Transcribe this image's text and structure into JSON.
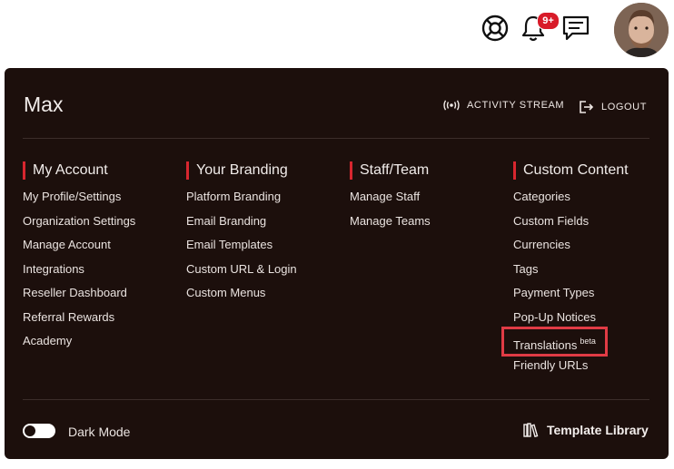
{
  "header": {
    "notification_badge": "9+",
    "icons": [
      "support-icon",
      "bell-icon",
      "chat-icon"
    ]
  },
  "panel": {
    "user_name": "Max",
    "activity_stream": "ACTIVITY STREAM",
    "logout": "LOGOUT",
    "columns": [
      {
        "title": "My Account",
        "items": [
          "My Profile/Settings",
          "Organization Settings",
          "Manage Account",
          "Integrations",
          "Reseller Dashboard",
          "Referral Rewards",
          "Academy"
        ]
      },
      {
        "title": "Your Branding",
        "items": [
          "Platform Branding",
          "Email Branding",
          "Email Templates",
          "Custom URL & Login",
          "Custom Menus"
        ]
      },
      {
        "title": "Staff/Team",
        "items": [
          "Manage Staff",
          "Manage Teams"
        ]
      },
      {
        "title": "Custom Content",
        "items": [
          "Categories",
          "Custom Fields",
          "Currencies",
          "Tags",
          "Payment Types",
          "Pop-Up Notices",
          "Translations",
          "Friendly URLs"
        ],
        "translations_badge": "beta"
      }
    ],
    "dark_mode_label": "Dark Mode",
    "dark_mode_on": false,
    "template_library": "Template Library"
  },
  "colors": {
    "panel_bg": "#1c0f0c",
    "accent": "#d8262f",
    "badge": "#d81b29",
    "highlight": "#e03b45"
  }
}
